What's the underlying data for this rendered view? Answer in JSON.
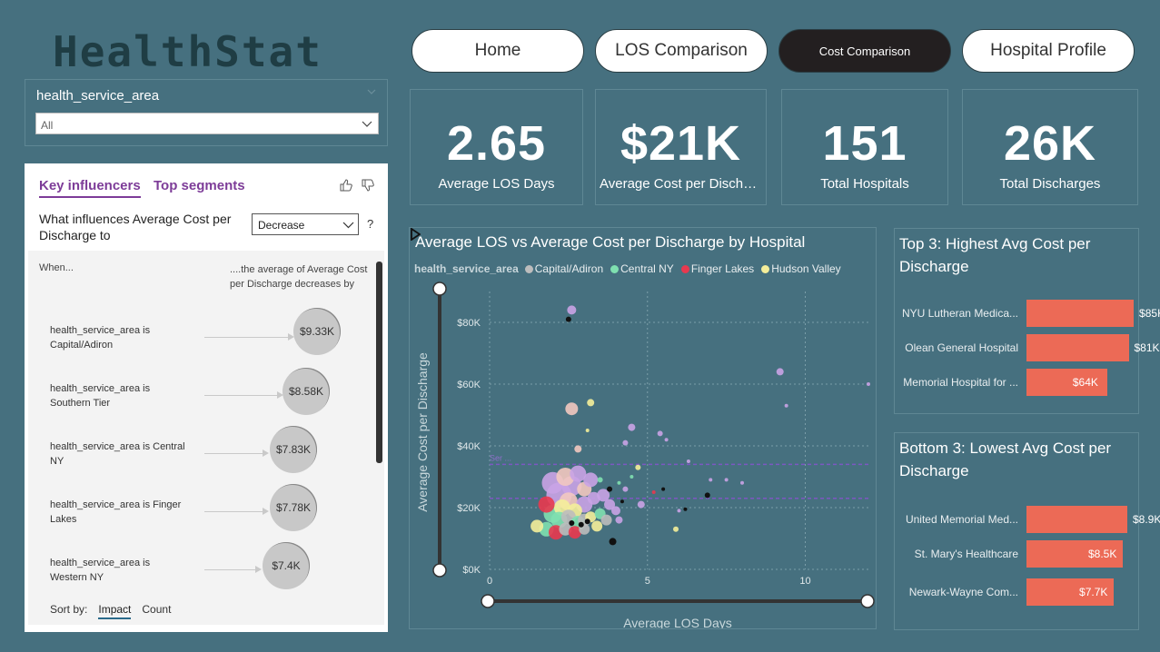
{
  "app": {
    "logo": "HealthStat"
  },
  "slicer": {
    "title": "health_service_area",
    "selected": "All"
  },
  "key_influencers": {
    "tabs": [
      "Key influencers",
      "Top segments"
    ],
    "question": "What influences Average Cost per Discharge to",
    "direction": "Decrease",
    "help": "?",
    "when_label": "When...",
    "then_label": "....the average of Average Cost per Discharge decreases by",
    "rows": [
      {
        "label": "health_service_area is Capital/Adiron",
        "value": "$9.33K"
      },
      {
        "label": "health_service_area is Southern Tier",
        "value": "$8.58K"
      },
      {
        "label": "health_service_area is Central NY",
        "value": "$7.83K"
      },
      {
        "label": "health_service_area is Finger Lakes",
        "value": "$7.78K"
      },
      {
        "label": "health_service_area is Western NY",
        "value": "$7.4K"
      }
    ],
    "sort_by_label": "Sort by:",
    "sort_options": [
      "Impact",
      "Count"
    ]
  },
  "nav": [
    "Home",
    "LOS Comparison",
    "Cost Comparison",
    "Hospital Profile"
  ],
  "kpis": [
    {
      "value": "2.65",
      "label": "Average LOS Days"
    },
    {
      "value": "$21K",
      "label": "Average Cost per Discharge"
    },
    {
      "value": "151",
      "label": "Total Hospitals"
    },
    {
      "value": "26K",
      "label": "Total Discharges"
    }
  ],
  "colors": {
    "background": "#46707f",
    "bar": "#ec6a56",
    "capital": "#bdbdbd",
    "central": "#7fe0b0",
    "finger": "#e8394f",
    "hudson": "#f4ee9a",
    "purple": "#c9a3e6",
    "pink": "#f2c8c0"
  },
  "chart_data": [
    {
      "type": "scatter",
      "title": "Average LOS vs Average Cost per Discharge by Hospital",
      "xlabel": "Average LOS Days",
      "ylabel": "Average Cost per Discharge",
      "xlim": [
        0,
        12
      ],
      "ylim": [
        0,
        90000
      ],
      "x_ticks": [
        "0",
        "5",
        "10"
      ],
      "y_ticks": [
        "$0K",
        "$20K",
        "$40K",
        "$60K",
        "$80K"
      ],
      "legend_title": "health_service_area",
      "legend": [
        "Capital/Adiron",
        "Central NY",
        "Finger Lakes",
        "Hudson Valley"
      ],
      "reference_lines": [
        34000,
        23000
      ],
      "reference_label": "Ser ...",
      "points": [
        {
          "x": 2.6,
          "y": 84000,
          "c": "purple",
          "s": 5
        },
        {
          "x": 2.5,
          "y": 81000,
          "c": "black",
          "s": 3
        },
        {
          "x": 9.2,
          "y": 64000,
          "c": "purple",
          "s": 4
        },
        {
          "x": 9.4,
          "y": 53000,
          "c": "purple",
          "s": 2
        },
        {
          "x": 12,
          "y": 60000,
          "c": "purple",
          "s": 2
        },
        {
          "x": 2.6,
          "y": 52000,
          "c": "pink",
          "s": 7
        },
        {
          "x": 3.2,
          "y": 54000,
          "c": "hudson",
          "s": 4
        },
        {
          "x": 3.1,
          "y": 45000,
          "c": "hudson",
          "s": 2
        },
        {
          "x": 4.5,
          "y": 46000,
          "c": "purple",
          "s": 4
        },
        {
          "x": 4.3,
          "y": 41000,
          "c": "purple",
          "s": 3
        },
        {
          "x": 5.4,
          "y": 44000,
          "c": "purple",
          "s": 3
        },
        {
          "x": 5.6,
          "y": 42000,
          "c": "purple",
          "s": 2
        },
        {
          "x": 2.8,
          "y": 39000,
          "c": "pink",
          "s": 4
        },
        {
          "x": 6.3,
          "y": 35000,
          "c": "purple",
          "s": 2
        },
        {
          "x": 7.0,
          "y": 29000,
          "c": "purple",
          "s": 2
        },
        {
          "x": 7.5,
          "y": 29000,
          "c": "purple",
          "s": 2
        },
        {
          "x": 8.0,
          "y": 28000,
          "c": "purple",
          "s": 2
        },
        {
          "x": 6.9,
          "y": 24000,
          "c": "black",
          "s": 3
        },
        {
          "x": 5.5,
          "y": 26000,
          "c": "black",
          "s": 2
        },
        {
          "x": 5.2,
          "y": 25000,
          "c": "red",
          "s": 2
        },
        {
          "x": 4.7,
          "y": 33000,
          "c": "hudson",
          "s": 3
        },
        {
          "x": 5.9,
          "y": 13000,
          "c": "hudson",
          "s": 3
        },
        {
          "x": 6.0,
          "y": 19000,
          "c": "purple",
          "s": 2
        },
        {
          "x": 6.2,
          "y": 19500,
          "c": "black",
          "s": 2
        },
        {
          "x": 2.0,
          "y": 28000,
          "c": "purple",
          "s": 12
        },
        {
          "x": 2.2,
          "y": 24000,
          "c": "purple",
          "s": 14
        },
        {
          "x": 2.4,
          "y": 30000,
          "c": "pink",
          "s": 10
        },
        {
          "x": 2.6,
          "y": 27000,
          "c": "purple",
          "s": 11
        },
        {
          "x": 2.8,
          "y": 31000,
          "c": "purple",
          "s": 9
        },
        {
          "x": 3.0,
          "y": 26000,
          "c": "pink",
          "s": 8
        },
        {
          "x": 3.2,
          "y": 29000,
          "c": "purple",
          "s": 8
        },
        {
          "x": 2.3,
          "y": 20000,
          "c": "hudson",
          "s": 9
        },
        {
          "x": 2.5,
          "y": 22000,
          "c": "pink",
          "s": 10
        },
        {
          "x": 2.7,
          "y": 19000,
          "c": "hudson",
          "s": 8
        },
        {
          "x": 3.0,
          "y": 21000,
          "c": "purple",
          "s": 9
        },
        {
          "x": 3.3,
          "y": 23000,
          "c": "purple",
          "s": 7
        },
        {
          "x": 3.6,
          "y": 24000,
          "c": "purple",
          "s": 7
        },
        {
          "x": 3.8,
          "y": 21000,
          "c": "purple",
          "s": 6
        },
        {
          "x": 1.8,
          "y": 21000,
          "c": "red",
          "s": 9
        },
        {
          "x": 2.0,
          "y": 18000,
          "c": "central",
          "s": 10
        },
        {
          "x": 2.2,
          "y": 16000,
          "c": "central",
          "s": 9
        },
        {
          "x": 2.5,
          "y": 17000,
          "c": "capital",
          "s": 8
        },
        {
          "x": 2.8,
          "y": 15000,
          "c": "central",
          "s": 8
        },
        {
          "x": 3.0,
          "y": 16000,
          "c": "capital",
          "s": 7
        },
        {
          "x": 3.2,
          "y": 17000,
          "c": "hudson",
          "s": 6
        },
        {
          "x": 3.5,
          "y": 18000,
          "c": "central",
          "s": 6
        },
        {
          "x": 3.7,
          "y": 16000,
          "c": "capital",
          "s": 6
        },
        {
          "x": 1.5,
          "y": 14000,
          "c": "hudson",
          "s": 7
        },
        {
          "x": 1.8,
          "y": 13000,
          "c": "central",
          "s": 8
        },
        {
          "x": 2.1,
          "y": 12000,
          "c": "red",
          "s": 8
        },
        {
          "x": 2.4,
          "y": 13000,
          "c": "capital",
          "s": 7
        },
        {
          "x": 2.7,
          "y": 12000,
          "c": "red",
          "s": 7
        },
        {
          "x": 3.0,
          "y": 13000,
          "c": "capital",
          "s": 6
        },
        {
          "x": 3.4,
          "y": 14000,
          "c": "hudson",
          "s": 6
        },
        {
          "x": 2.6,
          "y": 15000,
          "c": "black",
          "s": 3
        },
        {
          "x": 2.9,
          "y": 14500,
          "c": "black",
          "s": 3
        },
        {
          "x": 3.1,
          "y": 15500,
          "c": "black",
          "s": 3
        },
        {
          "x": 3.8,
          "y": 26000,
          "c": "black",
          "s": 3
        },
        {
          "x": 3.9,
          "y": 9000,
          "c": "black",
          "s": 4
        },
        {
          "x": 4.2,
          "y": 22000,
          "c": "black",
          "s": 2
        },
        {
          "x": 4.3,
          "y": 26000,
          "c": "purple",
          "s": 3
        },
        {
          "x": 4.8,
          "y": 21000,
          "c": "purple",
          "s": 4
        },
        {
          "x": 4.0,
          "y": 19000,
          "c": "purple",
          "s": 5
        },
        {
          "x": 4.1,
          "y": 16000,
          "c": "purple",
          "s": 4
        },
        {
          "x": 3.5,
          "y": 29000,
          "c": "central",
          "s": 3
        },
        {
          "x": 4.5,
          "y": 30000,
          "c": "central",
          "s": 2
        },
        {
          "x": 4.1,
          "y": 28000,
          "c": "central",
          "s": 2
        }
      ]
    },
    {
      "type": "bar",
      "title": "Top 3: Highest Avg Cost per Discharge",
      "categories": [
        "NYU Lutheran Medica...",
        "Olean General Hospital",
        "Memorial Hospital for ..."
      ],
      "values": [
        85,
        81,
        64
      ],
      "labels": [
        "$85K",
        "$81K",
        "$64K"
      ],
      "xlim": [
        0,
        88
      ]
    },
    {
      "type": "bar",
      "title": "Bottom 3: Lowest Avg Cost per Discharge",
      "categories": [
        "United Memorial Med...",
        "St. Mary's Healthcare",
        "Newark-Wayne Com..."
      ],
      "values": [
        8.9,
        8.5,
        7.7
      ],
      "labels": [
        "$8.9K",
        "$8.5K",
        "$7.7K"
      ],
      "xlim": [
        0,
        9.8
      ]
    }
  ]
}
